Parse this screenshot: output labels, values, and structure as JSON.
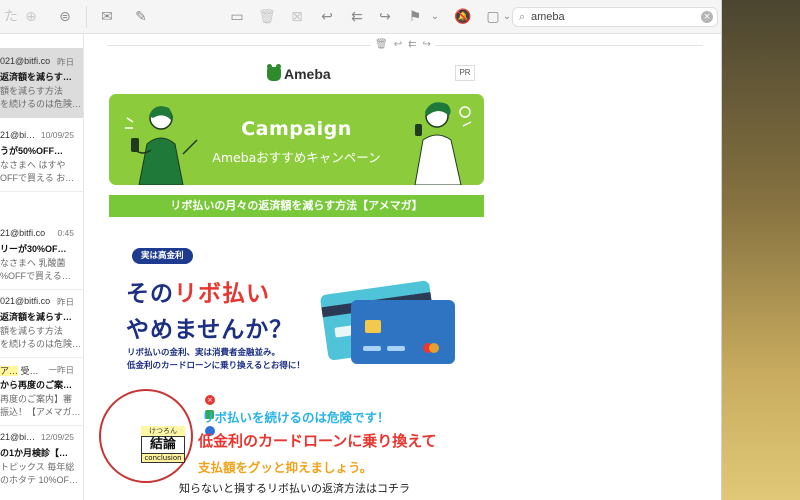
{
  "search": {
    "query": "ameba"
  },
  "mail_list": [
    {
      "from": "021@bitfi.co",
      "date": "昨日",
      "subject": "返済額を減らす…",
      "preview1": "額を減らす方法",
      "preview2": "を続けるのは危険…",
      "selected": true
    },
    {
      "from": "21@bi…",
      "date": "10/09/25",
      "subject": "うが50%OFF…",
      "preview1": "なさまへ はすや",
      "preview2": "OFFで買える お…",
      "selected": false
    },
    {
      "from": "21@bitfi.co",
      "date": "0:45",
      "subject": "リーが30%OF…",
      "preview1": "なさまへ 乳酸菌",
      "preview2": "%OFFで買える…",
      "selected": false
    },
    {
      "from": "021@bitfi.co",
      "date": "昨日",
      "subject": "返済額を減らす…",
      "preview1": "額を減らす方法",
      "preview2": "を続けるのは危険…",
      "selected": false
    },
    {
      "from": "受…",
      "date": "一昨日",
      "subject": "から再度のご案…",
      "preview1": "再度のご案内】審",
      "preview2": "振込！【アメマガ…",
      "selected": false
    },
    {
      "from": "21@bi…",
      "date": "12/09/25",
      "subject": "の1か月検診【…",
      "preview1": "トピックス 毎年総",
      "preview2": "のホタテ 10%OF…",
      "selected": false
    }
  ],
  "message": {
    "logo_text": "Ameba",
    "pr_label": "PR",
    "banner_title": "Campaign",
    "banner_subtitle": "Amebaおすすめキャンペーン",
    "ribbon": "リボ払いの月々の返済額を減らす方法【アメマガ】",
    "pill": "実は高金利",
    "headline_a": "その",
    "headline_red": "リボ払い",
    "headline_b": "やめませんか？",
    "desc1": "リボ払いの金利、実は消費者金融並み。",
    "desc2": "低金利のカードローンに乗り換えるとお得に！",
    "kw_ruby": "けつろん",
    "kw_kanji": "結論",
    "kw_eng": "conclusion",
    "line1": "リボ払いを続けるのは危険です！",
    "line2": "低金利のカードローンに乗り換えて",
    "line3": "支払額をグッと抑えましょう。",
    "line4": "知らないと損するリボ払いの返済方法はコチラ"
  },
  "colors": {
    "banner": "#8ccc3c",
    "navy": "#1c2f83",
    "red": "#e8352f",
    "cyan": "#2bb3e5",
    "orange": "#f0a21b"
  },
  "icons": [
    "trash-icon",
    "reply-icon",
    "reply-all-icon",
    "forward-icon",
    "flag-icon",
    "chevron-down-icon",
    "bell-slash-icon",
    "folder-icon",
    "search-icon",
    "close-icon",
    "archive-icon",
    "compose-icon",
    "mail-icon",
    "filter-icon",
    "new-icon"
  ]
}
